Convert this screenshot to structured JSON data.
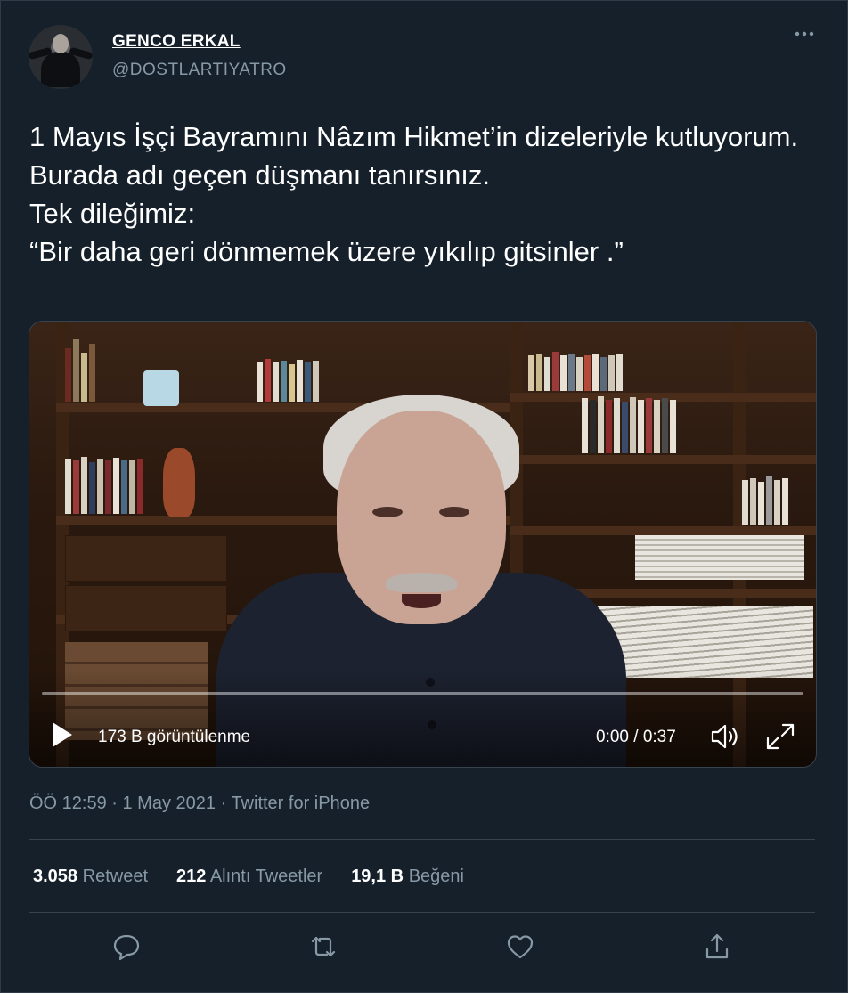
{
  "author": {
    "name": "GENCO ERKAL",
    "handle": "@DOSTLARTIYATRO"
  },
  "tweet": {
    "text": "1 Mayıs İşçi Bayramını Nâzım Hikmet’in dizeleriyle kutluyorum.\nBurada adı geçen düşmanı tanırsınız.\nTek dileğimiz:\n“Bir daha geri dönmemek üzere yıkılıp gitsinler .”"
  },
  "video": {
    "views": "173 B görüntülenme",
    "time": "0:00 / 0:37",
    "progress": 0.0
  },
  "meta": {
    "time": "ÖÖ 12:59",
    "date": "1 May 2021",
    "source": "Twitter for iPhone",
    "separator": " · "
  },
  "stats": {
    "retweet_count": "3.058",
    "retweet_label": "Retweet",
    "quote_count": "212",
    "quote_label": "Alıntı Tweetler",
    "like_count": "19,1 B",
    "like_label": "Beğeni"
  },
  "icons": {
    "more": "more-horizontal-icon",
    "play": "play-icon",
    "volume": "volume-icon",
    "fullscreen": "fullscreen-icon",
    "reply": "reply-icon",
    "retweet": "retweet-icon",
    "like": "heart-icon",
    "share": "share-icon"
  },
  "colors": {
    "background": "#15202b",
    "secondary_text": "#8899a6",
    "divider": "#38444d"
  }
}
